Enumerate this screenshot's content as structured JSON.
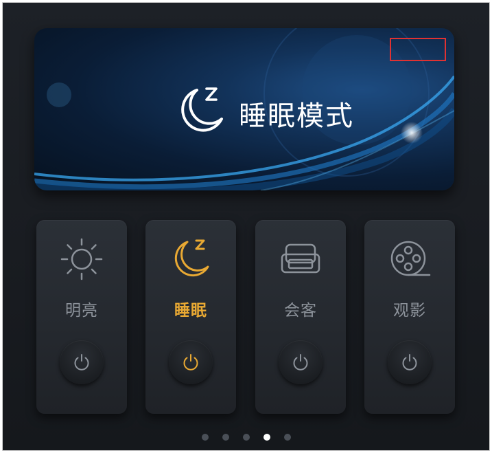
{
  "banner": {
    "title": "睡眠模式",
    "icon": "moon-zzz-icon"
  },
  "scenes": [
    {
      "label": "明亮",
      "icon": "sun-icon",
      "active": false
    },
    {
      "label": "睡眠",
      "icon": "moon-zzz-icon",
      "active": true
    },
    {
      "label": "会客",
      "icon": "sofa-icon",
      "active": false
    },
    {
      "label": "观影",
      "icon": "film-reel-icon",
      "active": false
    }
  ],
  "colors": {
    "accent": "#e9a933",
    "inactive": "#8d939b",
    "background": "#1b1e23"
  },
  "pager": {
    "count": 5,
    "active_index": 3
  }
}
